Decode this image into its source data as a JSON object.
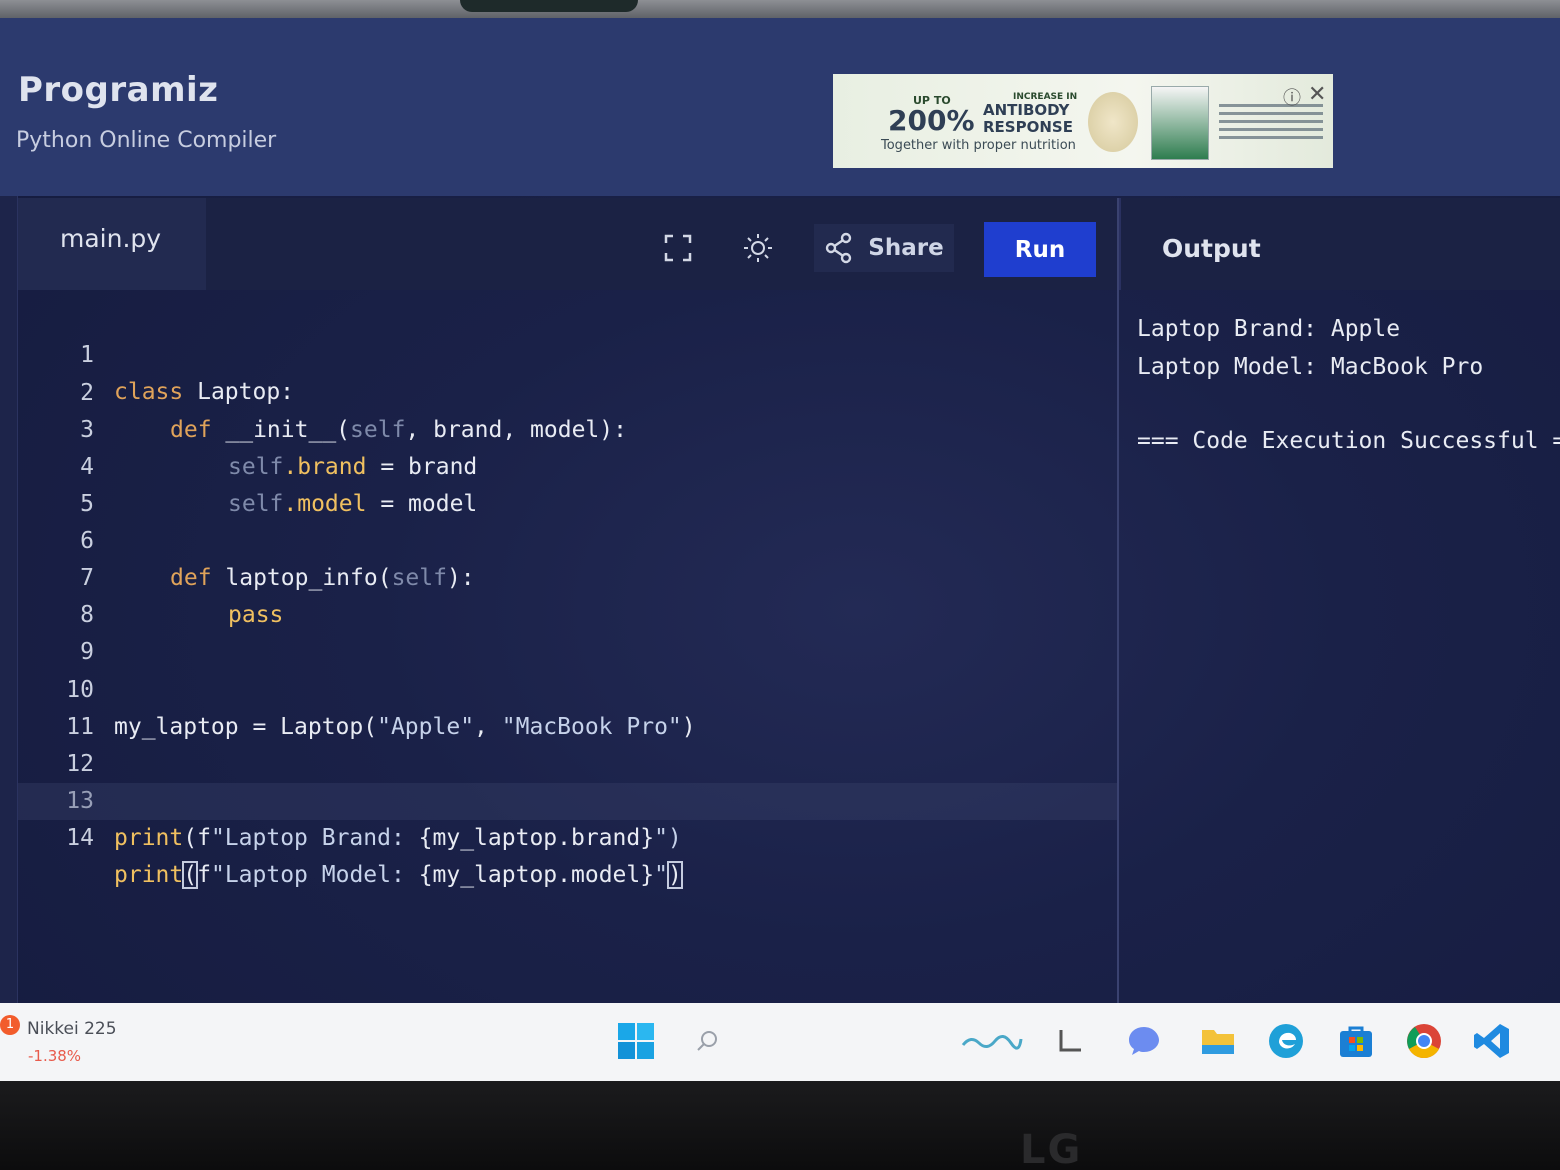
{
  "site": {
    "logo_text": "Programiz",
    "subtitle": "Python Online Compiler"
  },
  "ad": {
    "upto": "UP TO",
    "percent": "200%",
    "increase": "INCREASE IN",
    "antibody": "ANTIBODY",
    "response": "RESPONSE",
    "tagline": "Together with proper nutrition",
    "info_icon": "info-icon",
    "close_icon": "close-icon"
  },
  "editor": {
    "file_tab": "main.py",
    "share_label": "Share",
    "run_label": "Run",
    "lines": [
      {
        "n": "1"
      },
      {
        "n": "2"
      },
      {
        "n": "3"
      },
      {
        "n": "4"
      },
      {
        "n": "5"
      },
      {
        "n": "6"
      },
      {
        "n": "7"
      },
      {
        "n": "8"
      },
      {
        "n": "9"
      },
      {
        "n": "10"
      },
      {
        "n": "11"
      },
      {
        "n": "12"
      },
      {
        "n": "13"
      },
      {
        "n": "14"
      }
    ],
    "code": {
      "l1_kw": "class",
      "l1_rest": " Laptop:",
      "l2_kw": "def",
      "l2_a": " __init__(",
      "l2_self": "self",
      "l2_b": ", brand, model):",
      "l3_self": "self",
      "l3_attr": ".brand",
      "l3_rest": " = brand",
      "l4_self": "self",
      "l4_attr": ".model",
      "l4_rest": " = model",
      "l6_kw": "def",
      "l6_a": " laptop_info(",
      "l6_self": "self",
      "l6_b": "):",
      "l7_kw": "pass",
      "l10_a": "my_laptop = Laptop(",
      "l10_s1": "\"Apple\"",
      "l10_b": ", ",
      "l10_s2": "\"MacBook Pro\"",
      "l10_c": ")",
      "l13_fn": "print",
      "l13_a": "(f",
      "l13_s": "\"Laptop Brand: ",
      "l13_expr": "{my_laptop.brand}",
      "l13_e": "\")",
      "l14_fn": "print",
      "l14_open": "(",
      "l14_a": "f",
      "l14_s": "\"Laptop Model: ",
      "l14_expr": "{my_laptop.model}",
      "l14_q": "\"",
      "l14_close": ")"
    }
  },
  "output": {
    "title": "Output",
    "lines": [
      "Laptop Brand: Apple",
      "Laptop Model: MacBook Pro",
      "=== Code Execution Successful =="
    ]
  },
  "taskbar": {
    "widget_badge": "1",
    "widget_name": "Nikkei 225",
    "widget_change": "-1.38%",
    "icons": [
      "windows-start-icon",
      "search-icon",
      "widgets-icon",
      "task-view-icon",
      "chat-icon",
      "file-explorer-icon",
      "edge-icon",
      "store-icon",
      "chrome-icon",
      "vscode-icon"
    ]
  },
  "monitor": {
    "brand": "LG"
  }
}
